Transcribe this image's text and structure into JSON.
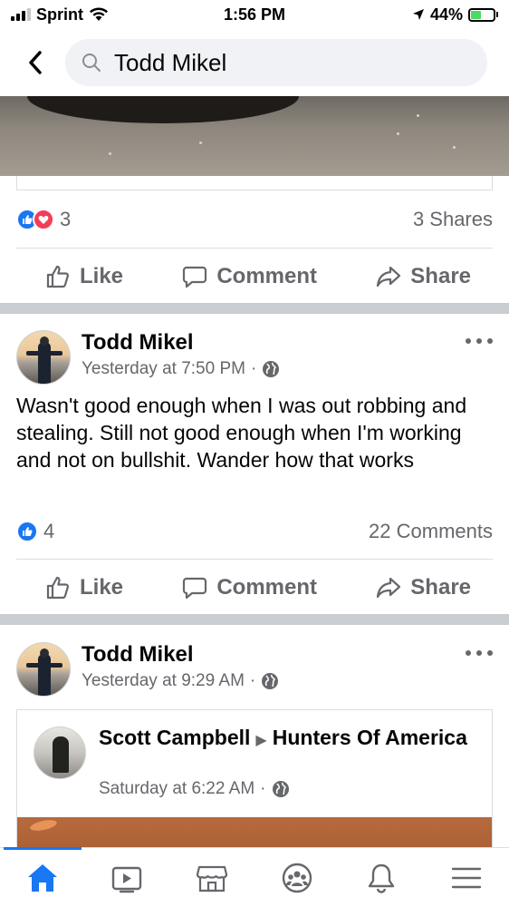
{
  "status_bar": {
    "carrier": "Sprint",
    "time": "1:56 PM",
    "battery": "44%",
    "battery_level": 0.44
  },
  "search": {
    "query": "Todd Mikel",
    "back_icon": "chevron-left-icon",
    "search_icon": "search-icon"
  },
  "previous_post": {
    "reaction_count": "3",
    "shares": "3 Shares",
    "reactions": [
      "like",
      "love"
    ]
  },
  "actions": {
    "like": "Like",
    "comment": "Comment",
    "share": "Share"
  },
  "posts": [
    {
      "author": "Todd Mikel",
      "timestamp": "Yesterday at 7:50 PM",
      "separator": "·",
      "privacy_icon": "globe-icon",
      "text": "Wasn't good enough when I was out robbing and stealing. Still not good enough when I'm working and not on bullshit. Wander how that works",
      "reaction_count": "4",
      "comments": "22 Comments"
    },
    {
      "author": "Todd Mikel",
      "timestamp": "Yesterday at 9:29 AM",
      "separator": "·",
      "privacy_icon": "globe-icon",
      "shared": {
        "author": "Scott Campbell",
        "target": "Hunters Of America",
        "timestamp": "Saturday at 6:22 AM",
        "separator": "·"
      }
    }
  ],
  "tab_bar": {
    "tabs": [
      "home-icon",
      "watch-icon",
      "marketplace-icon",
      "groups-icon",
      "notifications-icon",
      "menu-icon"
    ],
    "active": "home-icon"
  },
  "colors": {
    "accent": "#1877f2",
    "love": "#f33e58",
    "secondary_text": "#65676b",
    "divider": "#dadde1",
    "section_gap": "#c9ccd1"
  }
}
